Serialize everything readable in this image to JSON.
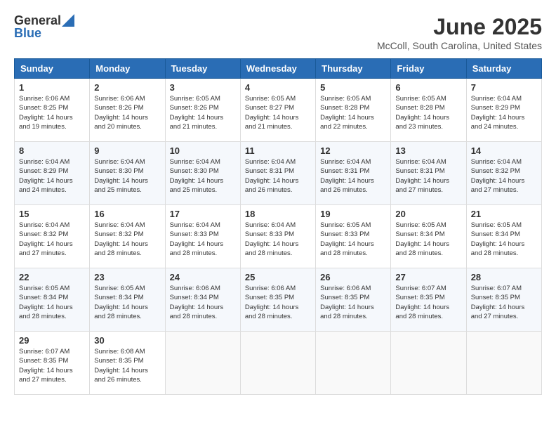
{
  "header": {
    "logo_general": "General",
    "logo_blue": "Blue",
    "month": "June 2025",
    "location": "McColl, South Carolina, United States"
  },
  "weekdays": [
    "Sunday",
    "Monday",
    "Tuesday",
    "Wednesday",
    "Thursday",
    "Friday",
    "Saturday"
  ],
  "weeks": [
    [
      {
        "day": "1",
        "sunrise": "6:06 AM",
        "sunset": "8:25 PM",
        "daylight": "14 hours and 19 minutes."
      },
      {
        "day": "2",
        "sunrise": "6:06 AM",
        "sunset": "8:26 PM",
        "daylight": "14 hours and 20 minutes."
      },
      {
        "day": "3",
        "sunrise": "6:05 AM",
        "sunset": "8:26 PM",
        "daylight": "14 hours and 21 minutes."
      },
      {
        "day": "4",
        "sunrise": "6:05 AM",
        "sunset": "8:27 PM",
        "daylight": "14 hours and 21 minutes."
      },
      {
        "day": "5",
        "sunrise": "6:05 AM",
        "sunset": "8:28 PM",
        "daylight": "14 hours and 22 minutes."
      },
      {
        "day": "6",
        "sunrise": "6:05 AM",
        "sunset": "8:28 PM",
        "daylight": "14 hours and 23 minutes."
      },
      {
        "day": "7",
        "sunrise": "6:04 AM",
        "sunset": "8:29 PM",
        "daylight": "14 hours and 24 minutes."
      }
    ],
    [
      {
        "day": "8",
        "sunrise": "6:04 AM",
        "sunset": "8:29 PM",
        "daylight": "14 hours and 24 minutes."
      },
      {
        "day": "9",
        "sunrise": "6:04 AM",
        "sunset": "8:30 PM",
        "daylight": "14 hours and 25 minutes."
      },
      {
        "day": "10",
        "sunrise": "6:04 AM",
        "sunset": "8:30 PM",
        "daylight": "14 hours and 25 minutes."
      },
      {
        "day": "11",
        "sunrise": "6:04 AM",
        "sunset": "8:31 PM",
        "daylight": "14 hours and 26 minutes."
      },
      {
        "day": "12",
        "sunrise": "6:04 AM",
        "sunset": "8:31 PM",
        "daylight": "14 hours and 26 minutes."
      },
      {
        "day": "13",
        "sunrise": "6:04 AM",
        "sunset": "8:31 PM",
        "daylight": "14 hours and 27 minutes."
      },
      {
        "day": "14",
        "sunrise": "6:04 AM",
        "sunset": "8:32 PM",
        "daylight": "14 hours and 27 minutes."
      }
    ],
    [
      {
        "day": "15",
        "sunrise": "6:04 AM",
        "sunset": "8:32 PM",
        "daylight": "14 hours and 27 minutes."
      },
      {
        "day": "16",
        "sunrise": "6:04 AM",
        "sunset": "8:32 PM",
        "daylight": "14 hours and 28 minutes."
      },
      {
        "day": "17",
        "sunrise": "6:04 AM",
        "sunset": "8:33 PM",
        "daylight": "14 hours and 28 minutes."
      },
      {
        "day": "18",
        "sunrise": "6:04 AM",
        "sunset": "8:33 PM",
        "daylight": "14 hours and 28 minutes."
      },
      {
        "day": "19",
        "sunrise": "6:05 AM",
        "sunset": "8:33 PM",
        "daylight": "14 hours and 28 minutes."
      },
      {
        "day": "20",
        "sunrise": "6:05 AM",
        "sunset": "8:34 PM",
        "daylight": "14 hours and 28 minutes."
      },
      {
        "day": "21",
        "sunrise": "6:05 AM",
        "sunset": "8:34 PM",
        "daylight": "14 hours and 28 minutes."
      }
    ],
    [
      {
        "day": "22",
        "sunrise": "6:05 AM",
        "sunset": "8:34 PM",
        "daylight": "14 hours and 28 minutes."
      },
      {
        "day": "23",
        "sunrise": "6:05 AM",
        "sunset": "8:34 PM",
        "daylight": "14 hours and 28 minutes."
      },
      {
        "day": "24",
        "sunrise": "6:06 AM",
        "sunset": "8:34 PM",
        "daylight": "14 hours and 28 minutes."
      },
      {
        "day": "25",
        "sunrise": "6:06 AM",
        "sunset": "8:35 PM",
        "daylight": "14 hours and 28 minutes."
      },
      {
        "day": "26",
        "sunrise": "6:06 AM",
        "sunset": "8:35 PM",
        "daylight": "14 hours and 28 minutes."
      },
      {
        "day": "27",
        "sunrise": "6:07 AM",
        "sunset": "8:35 PM",
        "daylight": "14 hours and 28 minutes."
      },
      {
        "day": "28",
        "sunrise": "6:07 AM",
        "sunset": "8:35 PM",
        "daylight": "14 hours and 27 minutes."
      }
    ],
    [
      {
        "day": "29",
        "sunrise": "6:07 AM",
        "sunset": "8:35 PM",
        "daylight": "14 hours and 27 minutes."
      },
      {
        "day": "30",
        "sunrise": "6:08 AM",
        "sunset": "8:35 PM",
        "daylight": "14 hours and 26 minutes."
      },
      null,
      null,
      null,
      null,
      null
    ]
  ]
}
